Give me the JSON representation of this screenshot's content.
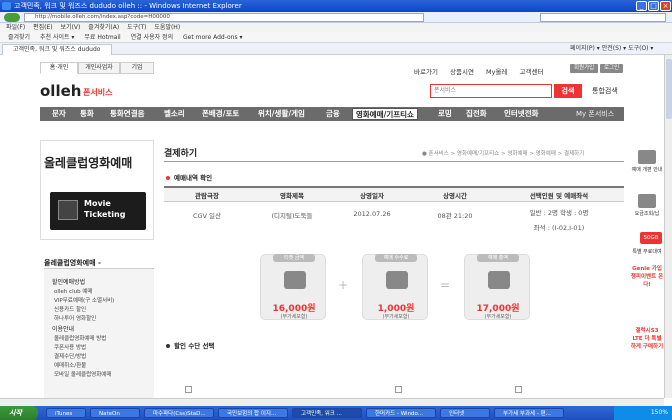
{
  "window": {
    "title": "고객민족, 워크 및 워즈스 dududo olleh :: - Windows Internet Explorer"
  },
  "browser": {
    "url": "http://mobile.olleh.com/index.asp?code=H00000",
    "search_placeholder": "",
    "menu": [
      "파일(F)",
      "편집(E)",
      "보기(V)",
      "즐겨찾기(A)",
      "도구(T)",
      "도움말(H)"
    ],
    "favorites": [
      "즐겨찾기",
      "추천 사이트 ▾",
      "무료 Hotmail",
      "연결 사용자 정의",
      "Get more Add-ons ▾"
    ],
    "tab_label": "고객민족, 워크 및 워즈스 dududo olleh",
    "toolbar_right": [
      "페이지(P) ▾",
      "안전(S) ▾",
      "도구(O) ▾"
    ]
  },
  "site": {
    "segments": [
      "홈·개인",
      "개인사업자",
      "기업"
    ],
    "logo": "olleh",
    "logo_sub": "폰서비스",
    "top_links": [
      "바로가기",
      "상품시연",
      "My올레",
      "고객센터"
    ],
    "pills": [
      "회원가입",
      "로그인"
    ],
    "search_placeholder": "폰서비스",
    "search_button": "검색",
    "all_search": "통합검색",
    "gnb": [
      "문자",
      "통화",
      "통화연결음",
      "벨소리",
      "폰배경/포토",
      "위치/생활/게임",
      "금융",
      "영화예매/기프티쇼",
      "로밍",
      "집전화",
      "인터넷전화"
    ],
    "gnb_active": "영화예매/기프티쇼",
    "gnb_right": "My 폰서비스"
  },
  "sidebar": {
    "banner_title": "올레클럽영화예매",
    "movie_label_1": "Movie",
    "movie_label_2": "Ticketing",
    "section": "올레클럽영화예매 -",
    "items": [
      {
        "label": "할인예매방법",
        "head": true
      },
      {
        "label": "olleh club 예매",
        "head": false
      },
      {
        "label": "VIP무료예매(구 소멸서비)",
        "head": false
      },
      {
        "label": "신용카드 할인",
        "head": false
      },
      {
        "label": "하나투어 영화할인",
        "head": false
      },
      {
        "label": "이용안내",
        "head": true
      },
      {
        "label": "올레클럽영화예매 방법",
        "head": false
      },
      {
        "label": "쿠폰사용 방법",
        "head": false
      },
      {
        "label": "결제수단/방법",
        "head": false
      },
      {
        "label": "예매취소/환불",
        "head": false
      },
      {
        "label": "모바일 올레클럽영화예매",
        "head": false
      }
    ]
  },
  "main": {
    "title": "결제하기",
    "breadcrumb": "● 폰서비스 > 영화예매/기프티쇼 > 영화예매 > 영화예매 > 결제하기",
    "section1": "예매내역 확인",
    "table": {
      "headers": [
        "관람극장",
        "영화제목",
        "상영일자",
        "상영시간",
        "선택인원 및 예매좌석"
      ],
      "row": [
        "CGV 일산",
        "(디지털)도둑들",
        "2012.07.26",
        "08관 21:20",
        "일반 : 2명    학생 : 0명"
      ],
      "seat": "좌석 : (I-02,I-01)"
    },
    "cash": [
      {
        "label": "티켓 금액",
        "amount": "16,000원",
        "note": "(부가세포함)"
      },
      {
        "label": "예매 수수료",
        "amount": "1,000원",
        "note": "(부가세포함)"
      },
      {
        "label": "예매 총액",
        "amount": "17,000원",
        "note": "(부가세포함)"
      }
    ],
    "ops": [
      "+",
      "="
    ],
    "section2": "할인 수단 선택"
  },
  "rail": [
    "예매 개편 안내",
    "요금조회/납",
    "50GB",
    "특별 무료대여",
    "Genie 가입 챙피이벤트 온다!",
    "갤럭시S3 LTE 더 특별하게 구매하기"
  ],
  "taskbar": {
    "start": "시작",
    "tasks": [
      "iTunes",
      "NateOn",
      "마수파다(Css)StaD...",
      "국민보험의 합 이지...",
      "고객민족, 워크 ...",
      "한머카드 - Windo...",
      "인터넷",
      "부가세 부과세 - 편..."
    ],
    "active_index": 4,
    "tray": "150%"
  }
}
